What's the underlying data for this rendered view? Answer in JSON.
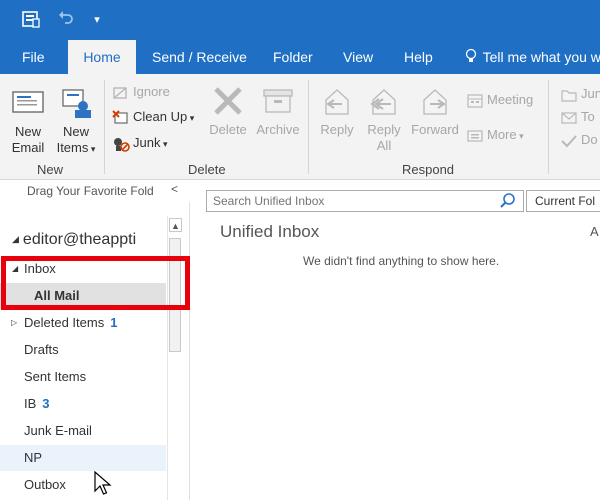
{
  "titlebar": {
    "icons": [
      "outlook-app-icon",
      "undo-icon",
      "customize-quick-access-icon"
    ]
  },
  "tabs": [
    "File",
    "Home",
    "Send / Receive",
    "Folder",
    "View",
    "Help",
    "Tell me what you w"
  ],
  "ribbon": {
    "new_email": "New\nEmail",
    "new_email_l1": "New",
    "new_email_l2": "Email",
    "new_items_l1": "New",
    "new_items_l2": "Items",
    "new_group": "New",
    "ignore": "Ignore",
    "clean_up": "Clean Up",
    "junk": "Junk",
    "delete": "Delete",
    "archive": "Archive",
    "delete_group": "Delete",
    "reply": "Reply",
    "reply_all_l1": "Reply",
    "reply_all_l2": "All",
    "forward": "Forward",
    "meeting": "Meeting",
    "more": "More",
    "respond_group": "Respond",
    "move_1": "Jun",
    "move_2": "To",
    "move_3": "Do"
  },
  "folder_pane": {
    "drag_hint": "Drag Your Favorite Fold",
    "account": "editor@theappti",
    "items": [
      {
        "label": "Inbox",
        "count": ""
      },
      {
        "label": "All Mail",
        "count": ""
      },
      {
        "label": "Deleted Items",
        "count": "1"
      },
      {
        "label": "Drafts",
        "count": ""
      },
      {
        "label": "Sent Items",
        "count": ""
      },
      {
        "label": "IB",
        "count": "3"
      },
      {
        "label": "Junk E-mail",
        "count": ""
      },
      {
        "label": "NP",
        "count": ""
      },
      {
        "label": "Outbox",
        "count": ""
      }
    ]
  },
  "main": {
    "search_placeholder": "Search Unified Inbox",
    "scope": "Current Fol",
    "title": "Unified Inbox",
    "sort_label": "A",
    "empty_message": "We didn't find anything to show here."
  },
  "colors": {
    "accent": "#1f6fc5",
    "highlight_box": "#e8000b",
    "count": "#1f6fc5"
  }
}
